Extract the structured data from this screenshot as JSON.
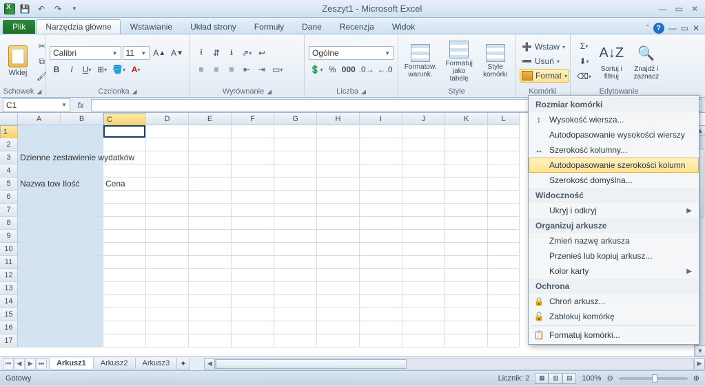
{
  "title": "Zeszyt1 - Microsoft Excel",
  "file_tab": "Plik",
  "tabs": [
    "Narzędzia główne",
    "Wstawianie",
    "Układ strony",
    "Formuły",
    "Dane",
    "Recenzja",
    "Widok"
  ],
  "active_tab_index": 0,
  "ribbon": {
    "clipboard": {
      "label": "Schowek",
      "paste": "Wklej"
    },
    "font": {
      "label": "Czcionka",
      "name": "Calibri",
      "size": "11"
    },
    "alignment": {
      "label": "Wyrównanie"
    },
    "number": {
      "label": "Liczba",
      "format": "Ogólne"
    },
    "styles": {
      "label": "Style",
      "cond": "Formatow. warunk.",
      "table": "Formatuj jako tabelę",
      "cell": "Style komórki"
    },
    "cells": {
      "label": "Komórki",
      "insert": "Wstaw",
      "delete": "Usuń",
      "format": "Format"
    },
    "editing": {
      "label": "Edytowanie",
      "sort": "Sortuj i filtruj",
      "find": "Znajdź i zaznacz"
    }
  },
  "namebox": "C1",
  "columns": [
    "A",
    "B",
    "C",
    "D",
    "E",
    "F",
    "G",
    "H",
    "I",
    "J",
    "K",
    "L"
  ],
  "rows": 17,
  "cells": {
    "A3": "Dzienne zestawienie wydatków",
    "A5": "Nazwa tow",
    "B5": "Ilość",
    "C5": "Cena"
  },
  "sheets": [
    "Arkusz1",
    "Arkusz2",
    "Arkusz3"
  ],
  "active_sheet_index": 0,
  "statusbar": {
    "ready": "Gotowy",
    "count": "Licznik: 2",
    "zoom": "100%"
  },
  "format_menu": {
    "sections": {
      "cellsize": "Rozmiar komórki",
      "visibility": "Widoczność",
      "organize": "Organizuj arkusze",
      "protection": "Ochrona"
    },
    "items": {
      "row_height": "Wysokość wiersza...",
      "autofit_rows": "Autodopasowanie wysokości wierszy",
      "col_width": "Szerokość kolumny...",
      "autofit_cols": "Autodopasowanie szerokości kolumn",
      "default_width": "Szerokość domyślna...",
      "hide_unhide": "Ukryj i odkryj",
      "rename": "Zmień nazwę arkusza",
      "move_copy": "Przenieś lub kopiuj arkusz...",
      "tab_color": "Kolor karty",
      "protect": "Chroń arkusz...",
      "lock": "Zablokuj komórkę",
      "format_cells": "Formatuj komórki..."
    }
  }
}
